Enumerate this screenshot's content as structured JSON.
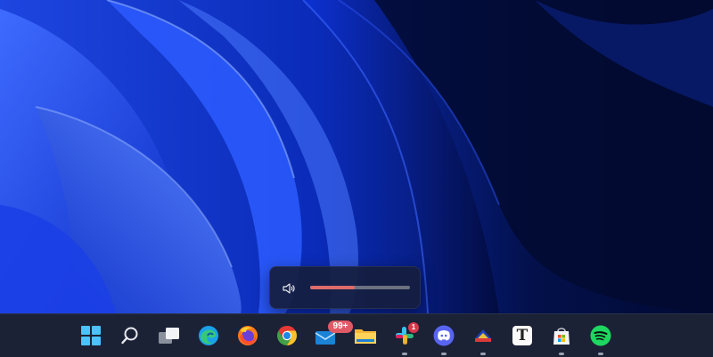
{
  "wallpaper": {
    "name": "windows-bloom-wallpaper"
  },
  "volume": {
    "level": 0.45,
    "icon": "speaker-icon",
    "fill_color": "#e06a6a"
  },
  "taskbar": {
    "items": [
      {
        "icon": "windows-start-icon"
      },
      {
        "icon": "search-icon"
      },
      {
        "icon": "task-view-icon"
      },
      {
        "icon": "edge-icon"
      },
      {
        "icon": "firefox-icon"
      },
      {
        "icon": "chrome-icon"
      },
      {
        "icon": "mail-icon",
        "badge": "99+"
      },
      {
        "icon": "file-explorer-icon"
      },
      {
        "icon": "slack-icon",
        "badge": "1",
        "running": true
      },
      {
        "icon": "discord-icon",
        "running": true
      },
      {
        "icon": "app-icon",
        "running": true
      },
      {
        "icon": "typora-icon",
        "letter": "T"
      },
      {
        "icon": "microsoft-store-icon",
        "running": true
      },
      {
        "icon": "spotify-icon",
        "running": true
      }
    ]
  }
}
